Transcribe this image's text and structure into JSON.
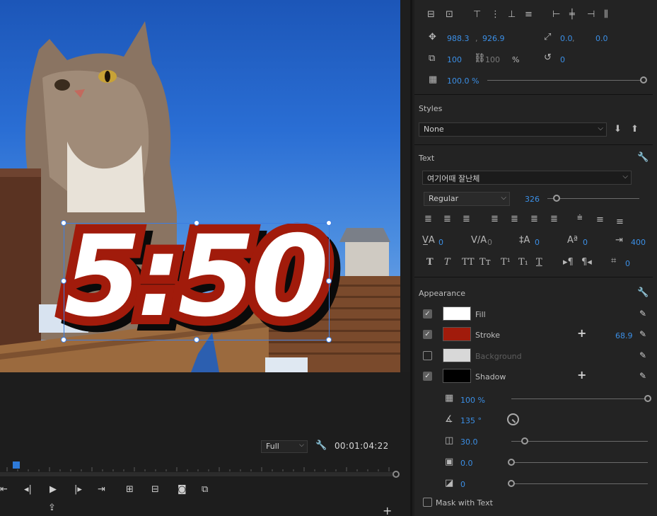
{
  "monitor": {
    "overlay_text": "5:50",
    "zoom": "Full",
    "timecode": "00:01:04:22"
  },
  "transform": {
    "position_x": "988.3",
    "position_y": "926.9",
    "anchor_x": "0.0",
    "anchor_y": "0.0",
    "scale": "100",
    "scale_width": "100",
    "scale_unit": "%",
    "rotation": "0",
    "opacity": "100.0 %"
  },
  "styles": {
    "title": "Styles",
    "selected": "None"
  },
  "text": {
    "title": "Text",
    "font": "여기어때 잘난체",
    "font_style": "Regular",
    "font_size": "326",
    "font_size_fraction": 0.1,
    "kerning": "0",
    "tracking": "0",
    "leading": "0",
    "baseline": "0",
    "tab_width": "400",
    "tsume": "0",
    "caption_style_value": "0"
  },
  "appearance": {
    "title": "Appearance",
    "fill": {
      "label": "Fill",
      "checked": true,
      "color": "#ffffff"
    },
    "stroke": {
      "label": "Stroke",
      "checked": true,
      "color": "#a11b0b",
      "width": "68.9"
    },
    "background": {
      "label": "Background",
      "checked": false,
      "color": "#d8d8d8"
    },
    "shadow": {
      "label": "Shadow",
      "checked": true,
      "color": "#000000",
      "opacity": "100 %",
      "opacity_fraction": 1.0,
      "angle": "135 °",
      "distance": "30.0",
      "distance_fraction": 0.1,
      "size": "0.0",
      "size_fraction": 0.0,
      "blur": "0",
      "blur_fraction": 0.0
    },
    "mask_with_text": {
      "label": "Mask with Text",
      "checked": false
    }
  },
  "colors": {
    "accent": "#3b8fe6",
    "stroke": "#a11b0b"
  }
}
